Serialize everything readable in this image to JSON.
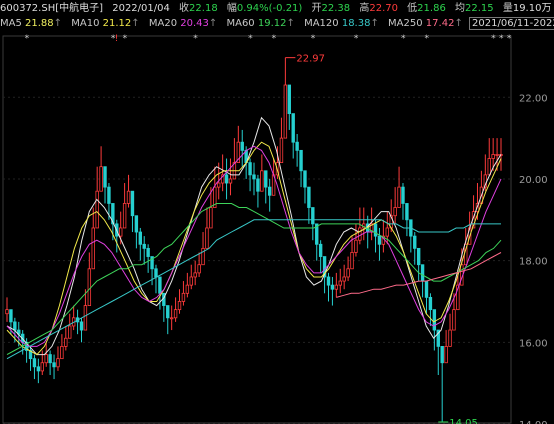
{
  "header": {
    "code": "600372.SH[中航电子]",
    "date": "2022/01/04",
    "close_label": "收",
    "close": "22.18",
    "change_label": "幅",
    "change": "0.94%(-0.21)",
    "open_label": "开",
    "open": "22.38",
    "high_label": "高",
    "high": "22.70",
    "low_label": "低",
    "low": "21.86",
    "avg_label": "均",
    "avg": "22.15",
    "volume_label": "量",
    "volume": "19.10万",
    "menu": "换"
  },
  "ma_legend": [
    {
      "name": "MA5",
      "value": "21.88",
      "color": "#e8e8e8"
    },
    {
      "name": "MA10",
      "value": "21.12",
      "color": "#f2e94a"
    },
    {
      "name": "MA20",
      "value": "20.43",
      "color": "#e040e0"
    },
    {
      "name": "MA60",
      "value": "19.12",
      "color": "#3ed45a"
    },
    {
      "name": "MA120",
      "value": "18.38",
      "color": "#38c8c8"
    },
    {
      "name": "MA250",
      "value": "17.42",
      "color": "#ff6b8a"
    }
  ],
  "range_label": "2021/06/11-2022/06/10(241日)",
  "chart_data": {
    "type": "candlestick",
    "title": "600372.SH[中航电子]",
    "date_range": "2021/06/11-2022/06/10",
    "ylim": [
      14.0,
      23.5
    ],
    "y_ticks": [
      "22.00",
      "20.00",
      "18.00",
      "16.00",
      "14.00"
    ],
    "y_tick_values": [
      22.0,
      20.0,
      18.0,
      16.0,
      14.0
    ],
    "annotations": [
      {
        "text": "22.97",
        "value": 22.97,
        "index": 71,
        "color": "#ff3b3b"
      },
      {
        "text": "14.05",
        "value": 14.05,
        "index": 110,
        "color": "#2dd34e"
      }
    ],
    "markers": [
      {
        "index": 5,
        "symbol": "*"
      },
      {
        "index": 27,
        "symbol": "*"
      },
      {
        "index": 28,
        "symbol": "!"
      },
      {
        "index": 30,
        "symbol": "*"
      },
      {
        "index": 48,
        "symbol": "*"
      },
      {
        "index": 62,
        "symbol": "*"
      },
      {
        "index": 68,
        "symbol": "*"
      },
      {
        "index": 78,
        "symbol": "*"
      },
      {
        "index": 89,
        "symbol": "*"
      },
      {
        "index": 101,
        "symbol": "*"
      },
      {
        "index": 107,
        "symbol": "*"
      },
      {
        "index": 124,
        "symbol": "*"
      },
      {
        "index": 126,
        "symbol": "*"
      },
      {
        "index": 128,
        "symbol": "*"
      }
    ],
    "closes": [
      16.8,
      16.5,
      16.3,
      16.2,
      16.0,
      15.8,
      15.6,
      15.4,
      15.3,
      15.5,
      15.7,
      15.5,
      15.4,
      15.6,
      15.9,
      16.1,
      16.4,
      16.6,
      16.5,
      16.3,
      16.9,
      17.8,
      18.8,
      19.7,
      20.3,
      19.8,
      19.4,
      18.9,
      18.6,
      18.8,
      19.4,
      19.7,
      19.1,
      18.7,
      18.4,
      18.3,
      18.1,
      17.8,
      17.6,
      17.2,
      16.9,
      16.6,
      16.6,
      16.8,
      17.0,
      17.2,
      17.4,
      17.6,
      17.7,
      17.9,
      18.3,
      18.8,
      19.3,
      19.8,
      19.9,
      20.1,
      19.9,
      20.0,
      20.4,
      20.9,
      20.7,
      20.4,
      20.1,
      20.0,
      19.7,
      20.2,
      19.8,
      19.6,
      20.1,
      20.4,
      21.0,
      22.3,
      21.6,
      20.9,
      20.7,
      20.2,
      19.8,
      19.3,
      18.9,
      18.4,
      18.1,
      17.6,
      17.4,
      17.3,
      17.4,
      17.5,
      17.6,
      17.8,
      18.2,
      18.5,
      18.8,
      18.9,
      18.7,
      18.9,
      18.6,
      18.4,
      18.6,
      18.8,
      19.1,
      19.3,
      19.8,
      19.4,
      19.0,
      18.6,
      18.3,
      17.9,
      17.5,
      17.1,
      16.8,
      16.3,
      15.9,
      15.5,
      15.9,
      16.3,
      16.8,
      17.4,
      17.9,
      18.4,
      18.8,
      19.2,
      19.4,
      19.8,
      20.1,
      20.5,
      20.6,
      20.6,
      20.6
    ],
    "highs": [
      17.1,
      16.8,
      16.6,
      16.5,
      16.3,
      16.1,
      15.9,
      15.7,
      15.6,
      15.8,
      16.0,
      15.8,
      15.7,
      15.9,
      16.2,
      16.4,
      16.7,
      16.9,
      16.8,
      16.6,
      17.3,
      18.2,
      19.3,
      20.3,
      20.8,
      20.3,
      19.9,
      19.3,
      19.0,
      19.2,
      19.9,
      20.1,
      19.5,
      19.1,
      18.8,
      18.6,
      18.4,
      18.1,
      17.9,
      17.5,
      17.2,
      16.9,
      16.9,
      17.1,
      17.3,
      17.5,
      17.7,
      17.9,
      18.0,
      18.2,
      18.7,
      19.3,
      19.8,
      20.3,
      20.4,
      20.6,
      20.5,
      20.5,
      21.0,
      21.3,
      21.2,
      20.8,
      20.5,
      20.4,
      20.1,
      20.6,
      20.2,
      20.0,
      20.5,
      20.8,
      21.5,
      22.97,
      22.1,
      21.4,
      21.1,
      20.6,
      20.2,
      19.7,
      19.3,
      18.8,
      18.5,
      18.0,
      17.7,
      17.6,
      17.7,
      17.8,
      17.9,
      18.1,
      18.6,
      18.9,
      19.3,
      19.3,
      19.1,
      19.3,
      19.0,
      18.8,
      19.0,
      19.2,
      19.5,
      19.8,
      20.3,
      19.9,
      19.4,
      19.0,
      18.7,
      18.3,
      17.9,
      17.5,
      17.2,
      16.7,
      16.3,
      15.9,
      16.3,
      16.7,
      17.2,
      17.8,
      18.3,
      18.8,
      19.2,
      19.6,
      19.9,
      20.2,
      20.6,
      21.0,
      21.0,
      21.0,
      21.0
    ],
    "lows": [
      16.5,
      16.2,
      16.0,
      15.9,
      15.7,
      15.5,
      15.3,
      15.1,
      15.0,
      15.2,
      15.4,
      15.2,
      15.1,
      15.3,
      15.6,
      15.8,
      16.1,
      16.3,
      16.2,
      16.0,
      16.6,
      17.4,
      18.4,
      19.2,
      19.8,
      19.4,
      19.0,
      18.5,
      18.2,
      18.4,
      19.0,
      19.3,
      18.7,
      18.3,
      18.0,
      17.9,
      17.7,
      17.4,
      17.2,
      16.8,
      16.5,
      16.2,
      16.3,
      16.5,
      16.7,
      16.9,
      17.1,
      17.3,
      17.4,
      17.6,
      17.9,
      18.4,
      18.9,
      19.4,
      19.5,
      19.7,
      19.5,
      19.6,
      20.0,
      20.5,
      20.3,
      20.0,
      19.7,
      19.6,
      19.3,
      19.8,
      19.4,
      19.2,
      19.7,
      20.0,
      20.6,
      21.8,
      21.2,
      20.5,
      20.3,
      19.8,
      19.4,
      18.9,
      18.5,
      18.0,
      17.7,
      17.2,
      17.0,
      16.9,
      17.1,
      17.2,
      17.3,
      17.5,
      17.8,
      18.1,
      18.4,
      18.5,
      18.3,
      18.5,
      18.2,
      18.0,
      18.2,
      18.4,
      18.7,
      18.9,
      19.4,
      19.0,
      18.6,
      18.2,
      17.9,
      17.5,
      17.1,
      16.7,
      16.4,
      15.8,
      15.2,
      14.05,
      15.5,
      15.9,
      16.4,
      17.0,
      17.5,
      18.0,
      18.4,
      18.8,
      19.0,
      19.4,
      19.7,
      20.1,
      20.2,
      20.2,
      20.2
    ],
    "ma_lines": [
      {
        "name": "MA5",
        "color": "#e8e8e8",
        "values": [
          16.4,
          16.3,
          16.1,
          15.9,
          15.7,
          15.7,
          15.9,
          16.3,
          16.9,
          17.6,
          18.5,
          19.2,
          19.5,
          19.3,
          19.0,
          18.6,
          18.2,
          17.8,
          17.3,
          17.0,
          16.9,
          17.1,
          17.5,
          18.0,
          18.6,
          19.2,
          19.8,
          20.1,
          20.3,
          20.2,
          20.1,
          20.1,
          20.4,
          20.9,
          21.5,
          21.3,
          20.7,
          19.9,
          19.1,
          18.2,
          17.6,
          17.4,
          17.5,
          17.9,
          18.4,
          18.7,
          18.8,
          18.7,
          18.8,
          19.0,
          19.2,
          19.2,
          18.8,
          18.2,
          17.6,
          17.0,
          16.4,
          16.1,
          16.3,
          16.9,
          17.6,
          18.3,
          18.9,
          19.4,
          19.9,
          20.3,
          20.6
        ]
      },
      {
        "name": "MA10",
        "color": "#f2e94a",
        "values": [
          16.3,
          16.1,
          15.9,
          15.8,
          15.7,
          15.9,
          16.3,
          16.9,
          17.6,
          18.3,
          18.8,
          19.1,
          19.2,
          19.0,
          18.7,
          18.3,
          17.9,
          17.5,
          17.2,
          17.0,
          17.0,
          17.3,
          17.7,
          18.2,
          18.7,
          19.2,
          19.6,
          19.9,
          20.1,
          20.2,
          20.2,
          20.2,
          20.4,
          20.7,
          20.9,
          20.8,
          20.3,
          19.6,
          18.9,
          18.2,
          17.8,
          17.6,
          17.6,
          17.8,
          18.1,
          18.4,
          18.6,
          18.7,
          18.8,
          18.9,
          19.0,
          18.9,
          18.6,
          18.2,
          17.7,
          17.2,
          16.7,
          16.5,
          16.6,
          17.0,
          17.5,
          18.1,
          18.7,
          19.2,
          19.7,
          20.1,
          20.5
        ]
      },
      {
        "name": "MA20",
        "color": "#e040e0",
        "values": [
          16.4,
          16.2,
          16.0,
          15.9,
          15.9,
          16.0,
          16.3,
          16.7,
          17.2,
          17.7,
          18.1,
          18.4,
          18.5,
          18.4,
          18.2,
          17.9,
          17.6,
          17.3,
          17.1,
          17.0,
          17.1,
          17.3,
          17.7,
          18.1,
          18.5,
          18.9,
          19.3,
          19.6,
          19.9,
          20.1,
          20.3,
          20.5,
          20.7,
          20.8,
          20.7,
          20.4,
          19.9,
          19.3,
          18.7,
          18.2,
          17.9,
          17.7,
          17.7,
          17.9,
          18.1,
          18.3,
          18.5,
          18.6,
          18.7,
          18.7,
          18.6,
          18.4,
          18.0,
          17.6,
          17.2,
          16.8,
          16.5,
          16.4,
          16.5,
          16.8,
          17.2,
          17.7,
          18.2,
          18.7,
          19.2,
          19.6,
          20.0
        ]
      },
      {
        "name": "MA60",
        "color": "#3ed45a",
        "values": [
          15.7,
          15.8,
          15.9,
          16.0,
          16.1,
          16.2,
          16.3,
          16.5,
          16.7,
          16.9,
          17.1,
          17.3,
          17.5,
          17.6,
          17.7,
          17.8,
          17.8,
          17.9,
          17.9,
          18.0,
          18.1,
          18.3,
          18.4,
          18.6,
          18.8,
          19.0,
          19.2,
          19.3,
          19.4,
          19.4,
          19.4,
          19.3,
          19.3,
          19.2,
          19.1,
          19.0,
          18.9,
          18.8,
          18.8,
          18.8,
          18.8,
          18.8,
          18.9,
          18.9,
          18.9,
          18.9,
          18.9,
          18.9,
          18.8,
          18.7,
          18.6,
          18.5,
          18.3,
          18.1,
          17.9,
          17.7,
          17.6,
          17.5,
          17.5,
          17.6,
          17.7,
          17.8,
          17.9,
          18.0,
          18.2,
          18.3,
          18.5
        ]
      },
      {
        "name": "MA120",
        "color": "#38c8c8",
        "values": [
          15.6,
          15.7,
          15.8,
          15.9,
          16.0,
          16.1,
          16.2,
          16.3,
          16.4,
          16.5,
          16.6,
          16.7,
          16.8,
          16.9,
          17.0,
          17.1,
          17.2,
          17.3,
          17.4,
          17.5,
          17.6,
          17.7,
          17.8,
          17.9,
          18.0,
          18.1,
          18.2,
          18.3,
          18.5,
          18.6,
          18.7,
          18.8,
          18.9,
          19.0,
          19.0,
          19.0,
          19.0,
          19.0,
          19.0,
          19.0,
          19.0,
          19.0,
          19.0,
          19.0,
          19.0,
          19.0,
          19.0,
          19.0,
          19.0,
          19.0,
          19.0,
          18.9,
          18.9,
          18.8,
          18.8,
          18.7,
          18.7,
          18.7,
          18.7,
          18.7,
          18.8,
          18.8,
          18.9,
          18.9,
          18.9,
          18.9,
          18.9
        ]
      },
      {
        "name": "MA250",
        "color": "#ff6b8a",
        "values": [
          null,
          null,
          null,
          null,
          null,
          null,
          null,
          null,
          null,
          null,
          null,
          null,
          null,
          null,
          null,
          null,
          null,
          null,
          null,
          null,
          null,
          null,
          null,
          null,
          null,
          null,
          null,
          null,
          null,
          null,
          null,
          null,
          null,
          null,
          null,
          null,
          null,
          null,
          null,
          null,
          null,
          null,
          null,
          null,
          17.1,
          17.15,
          17.2,
          17.2,
          17.25,
          17.3,
          17.3,
          17.35,
          17.4,
          17.4,
          17.45,
          17.5,
          17.5,
          17.55,
          17.6,
          17.65,
          17.7,
          17.75,
          17.8,
          17.9,
          18.0,
          18.1,
          18.2
        ]
      }
    ]
  }
}
